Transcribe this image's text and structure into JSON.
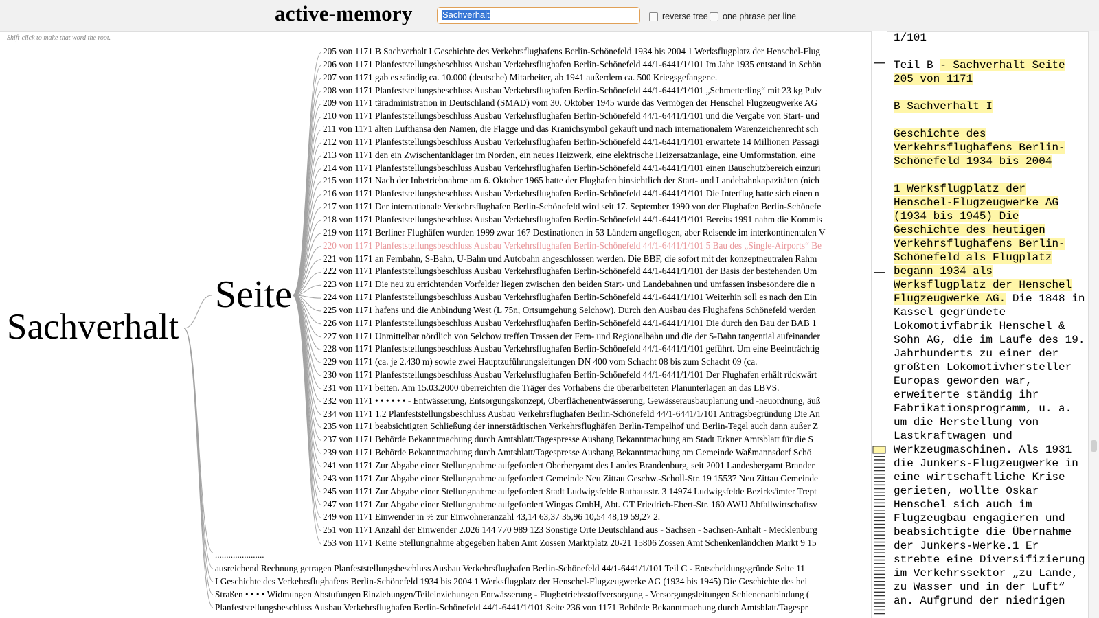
{
  "header": {
    "title": "active-memory",
    "search_value": "Sachverhalt",
    "reverse_tree_label": "reverse tree",
    "one_phrase_label": "one phrase per line"
  },
  "hint": "Shift-click to make that word the root.",
  "tree": {
    "root_word": "Sachverhalt",
    "branch_word": "Seite",
    "highlight_index": 15,
    "branch_lines": [
      "205 von 1171 B Sachverhalt I Geschichte des Verkehrsflughafens Berlin-Schönefeld 1934 bis 2004 1 Werksflugplatz der Henschel-Flug",
      "206 von 1171 Planfeststellungsbeschluss Ausbau Verkehrsflughafen Berlin-Schönefeld 44/1-6441/1/101 Im Jahr 1935 entstand in Schön",
      "207 von 1171 gab es ständig ca. 10.000 (deutsche) Mitarbeiter, ab 1941 außerdem ca. 500 Kriegsgefangene.",
      "208 von 1171 Planfeststellungsbeschluss Ausbau Verkehrsflughafen Berlin-Schönefeld 44/1-6441/1/101 „Schmetterling“ mit 23 kg Pulv",
      "209 von 1171 täradministration in Deutschland (SMAD) vom 30. Oktober 1945 wurde das Vermögen der Henschel Flugzeugwerke AG",
      "210 von 1171 Planfeststellungsbeschluss Ausbau Verkehrsflughafen Berlin-Schönefeld 44/1-6441/1/101 und die Vergabe von Start- und",
      "211 von 1171 alten Lufthansa den Namen, die Flagge und das Kranichsymbol gekauft und nach internationalem Warenzeichenrecht sch",
      "212 von 1171 Planfeststellungsbeschluss Ausbau Verkehrsflughafen Berlin-Schönefeld 44/1-6441/1/101 erwartete 14 Millionen Passagi",
      "213 von 1171 den ein Zwischentanklager im Norden, ein neues Heizwerk, eine elektrische Heizersatzanlage, eine Umformstation, eine",
      "214 von 1171 Planfeststellungsbeschluss Ausbau Verkehrsflughafen Berlin-Schönefeld 44/1-6441/1/101 einen Bauschutzbereich einzuri",
      "215 von 1171 Nach der Inbetriebnahme am 6. Oktober 1965 hatte der Flughafen hinsichtlich der Start- und Landebahnkapazitäten (nich",
      "216 von 1171 Planfeststellungsbeschluss Ausbau Verkehrsflughafen Berlin-Schönefeld 44/1-6441/1/101 Die Interflug hatte sich einen n",
      "217 von 1171 Der internationale Verkehrsflughafen Berlin-Schönefeld wird seit 17. September 1990 von der Flughafen Berlin-Schönefe",
      "218 von 1171 Planfeststellungsbeschluss Ausbau Verkehrsflughafen Berlin-Schönefeld 44/1-6441/1/101 Bereits 1991 nahm die Kommis",
      "219 von 1171 Berliner Flughäfen wurden 1999 zwar 167 Destinationen in 53 Ländern angeflogen, aber Reisende im interkontinentalen V",
      "220 von 1171 Planfeststellungsbeschluss Ausbau Verkehrsflughafen Berlin-Schönefeld 44/1-6441/1/101 5 Bau des „Single-Airports“ Be",
      "221 von 1171 an Fernbahn, S-Bahn, U-Bahn und Autobahn angeschlossen werden. Die BBF, die sofort mit der konzeptneutralen Rahm",
      "222 von 1171 Planfeststellungsbeschluss Ausbau Verkehrsflughafen Berlin-Schönefeld 44/1-6441/1/101 der Basis der bestehenden Um",
      "223 von 1171 Die neu zu errichtenden Vorfelder liegen zwischen den beiden Start- und Landebahnen und umfassen insbesondere die n",
      "224 von 1171 Planfeststellungsbeschluss Ausbau Verkehrsflughafen Berlin-Schönefeld 44/1-6441/1/101 Weiterhin soll es nach den Ein",
      "225 von 1171 hafens und die Anbindung West (L 75n, Ortsumgehung Selchow). Durch den Ausbau des Flughafens Schönefeld werden",
      "226 von 1171 Planfeststellungsbeschluss Ausbau Verkehrsflughafen Berlin-Schönefeld 44/1-6441/1/101 Die durch den Bau der BAB 1",
      "227 von 1171 Unmittelbar nördlich von Selchow treffen Trassen der Fern- und Regionalbahn und die der S-Bahn tangential aufeinander",
      "228 von 1171 Planfeststellungsbeschluss Ausbau Verkehrsflughafen Berlin-Schönefeld 44/1-6441/1/101 geführt. Um eine Beeinträchtig",
      "229 von 1171 (ca. je 2.430 m) sowie zwei Hauptzuführungsleitungen DN 400 vom Schacht 08 bis zum Schacht 09 (ca.",
      "230 von 1171 Planfeststellungsbeschluss Ausbau Verkehrsflughafen Berlin-Schönefeld 44/1-6441/1/101 Der Flughafen erhält rückwärt",
      "231 von 1171 beiten. Am 15.03.2000 überreichten die Träger des Vorhabens die überarbeiteten Planunterlagen an das LBVS.",
      "232 von 1171 • • • • • • - Entwässerung, Entsorgungskonzept, Oberflächenentwässerung, Gewässerausbauplanung und -neuordnung, äuß",
      "234 von 1171 1.2 Planfeststellungsbeschluss Ausbau Verkehrsflughafen Berlin-Schönefeld 44/1-6441/1/101 Antragsbegründung Die An",
      "235 von 1171 beabsichtigten Schließung der innerstädtischen Verkehrsflughäfen Berlin-Tempelhof und Berlin-Tegel auch dann außer Z",
      "237 von 1171 Behörde Bekanntmachung durch Amtsblatt/Tagespresse Aushang Bekanntmachung am Stadt Erkner Amtsblatt für die S",
      "239 von 1171 Behörde Bekanntmachung durch Amtsblatt/Tagespresse Aushang Bekanntmachung am Gemeinde Waßmannsdorf Schö",
      "241 von 1171 Zur Abgabe einer Stellungnahme aufgefordert Oberbergamt des Landes Brandenburg, seit 2001 Landesbergamt Brander",
      "243 von 1171 Zur Abgabe einer Stellungnahme aufgefordert Gemeinde Neu Zittau Geschw.-Scholl-Str. 19 15537 Neu Zittau Gemeinde",
      "245 von 1171 Zur Abgabe einer Stellungnahme aufgefordert Stadt Ludwigsfelde Rathausstr. 3 14974 Ludwigsfelde Bezirksämter Trept",
      "247 von 1171 Zur Abgabe einer Stellungnahme aufgefordert Wingas GmbH, Abt. GT Friedrich-Ebert-Str. 160 AWU Abfallwirtschaftsv",
      "249 von 1171 Einwender in % zur Einwohneranzahl 43,14 63,37 35,96 10,54 48,19 59,27 2.",
      "251 von 1171 Anzahl der Einwender 2.026 144 770 989 123 Sonstige Orte Deutschland aus - Sachsen - Sachsen-Anhalt - Mecklenburg",
      "253 von 1171 Keine Stellungnahme abgegeben haben Amt Zossen Marktplatz 20-21 15806 Zossen Amt Schenkenländchen Markt 9 15"
    ],
    "dots": "......................",
    "root_lines": [
      "ausreichend Rechnung getragen Planfeststellungsbeschluss Ausbau Verkehrsflughafen Berlin-Schönefeld 44/1-6441/1/101 Teil C - Entscheidungsgründe Seite 11",
      "I Geschichte des Verkehrsflughafens Berlin-Schönefeld 1934 bis 2004 1 Werksflugplatz der Henschel-Flugzeugwerke AG (1934 bis 1945) Die Geschichte des hei",
      "Straßen • • • • Widmungen Abstufungen Einziehungen/Teileinziehungen Entwässerung - Flugbetriebsstoffversorgung - Versorgungsleitungen Schienenanbindung (",
      "Planfeststellungsbeschluss Ausbau Verkehrsflughafen Berlin-Schönefeld 44/1-6441/1/101 Seite 236 von 1171 Behörde Bekanntmachung durch Amtsblatt/Tagespr"
    ]
  },
  "panel": {
    "paragraphs": [
      [
        {
          "t": "1/101",
          "m": false
        }
      ],
      [
        {
          "t": "Teil B ",
          "m": false
        },
        {
          "t": "- Sachverhalt Seite 205 von 1171",
          "m": true
        }
      ],
      [
        {
          "t": "B Sachverhalt I",
          "m": true
        }
      ],
      [
        {
          "t": "Geschichte des Verkehrsflughafens Berlin-Schönefeld 1934 bis 2004",
          "m": true
        }
      ],
      [
        {
          "t": "1 Werksflugplatz der Henschel-Flugzeugwerke AG (1934 bis 1945) Die Geschichte des heutigen Verkehrsflughafens Berlin-Schönefeld als Flugplatz begann 1934 als Werksflugplatz der Henschel Flugzeugwerke AG.",
          "m": true
        },
        {
          "t": " Die 1848 in Kassel gegründete Lokomotivfabrik Henschel & Sohn AG, die im Laufe des 19. Jahrhunderts zu einer der größten Lokomotivhersteller Europas geworden war, erweiterte ständig ihr Fabrikationsprogramm, u. a. um die Herstellung von Lastkraftwagen und Werkzeugmaschinen. Als 1931 die Junkers-Flugzeugwerke in eine wirtschaftliche Krise gerieten, wollte Oskar Henschel sich auch im Flugzeugbau engagieren und beabsichtigte die Übernahme der Junkers-Werke.1 Er strebte eine Diversifizierung im Verkehrssektor „zu Lande, zu Wasser und in der Luft“ an. Aufgrund der niedrigen",
          "m": false
        }
      ]
    ]
  }
}
